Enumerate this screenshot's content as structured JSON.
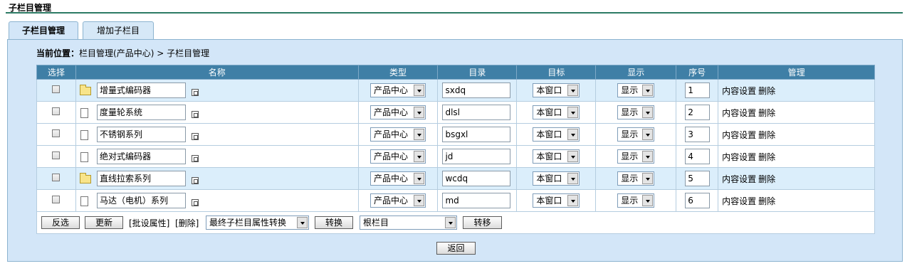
{
  "page": {
    "title": "子栏目管理"
  },
  "tabs": [
    {
      "label": "子栏目管理",
      "active": true
    },
    {
      "label": "增加子栏目",
      "active": false
    }
  ],
  "breadcrumb": {
    "prefix": "当前位置：",
    "path": "栏目管理(产品中心) > 子栏目管理"
  },
  "table": {
    "headers": [
      "选择",
      "名称",
      "类型",
      "目录",
      "目标",
      "显示",
      "序号",
      "管理"
    ],
    "rows": [
      {
        "icon": "folder-icon",
        "name": "增量式编码器",
        "type": "产品中心",
        "dir": "sxdq",
        "target": "本窗口",
        "show": "显示",
        "order": "1",
        "highlight": true
      },
      {
        "icon": "page-icon",
        "name": "度量轮系统",
        "type": "产品中心",
        "dir": "dlsl",
        "target": "本窗口",
        "show": "显示",
        "order": "2",
        "highlight": false
      },
      {
        "icon": "page-icon",
        "name": "不锈钢系列",
        "type": "产品中心",
        "dir": "bsgxl",
        "target": "本窗口",
        "show": "显示",
        "order": "3",
        "highlight": false
      },
      {
        "icon": "page-icon",
        "name": "绝对式编码器",
        "type": "产品中心",
        "dir": "jd",
        "target": "本窗口",
        "show": "显示",
        "order": "4",
        "highlight": false
      },
      {
        "icon": "folder-icon",
        "name": "直线拉索系列",
        "type": "产品中心",
        "dir": "wcdq",
        "target": "本窗口",
        "show": "显示",
        "order": "5",
        "highlight": true
      },
      {
        "icon": "page-icon",
        "name": "马达（电机）系列",
        "type": "产品中心",
        "dir": "md",
        "target": "本窗口",
        "show": "显示",
        "order": "6",
        "highlight": false
      }
    ],
    "actions": {
      "settings": "内容设置",
      "delete": "删除"
    }
  },
  "footer": {
    "invert_button": "反选",
    "update_button": "更新",
    "batch_attr_link": "[批设属性]",
    "batch_delete_link": "[删除]",
    "convert_select": "最终子栏目属性转换",
    "convert_button": "转换",
    "move_select": "根栏目",
    "move_button": "转移"
  },
  "back_button": "返回"
}
